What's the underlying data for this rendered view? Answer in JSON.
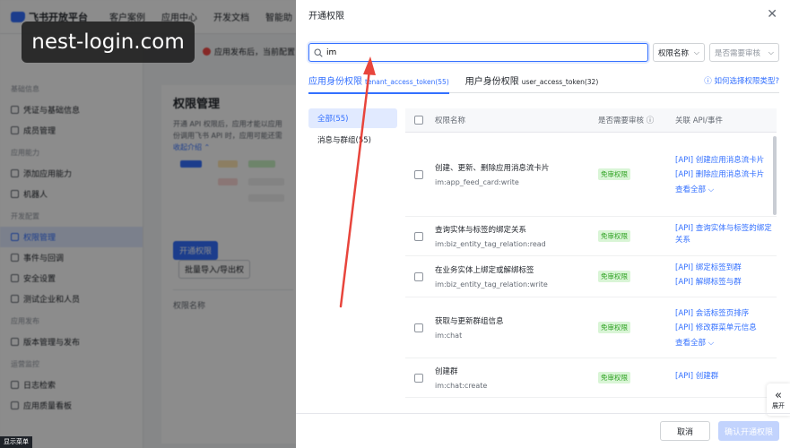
{
  "background": {
    "logo": "飞书开放平台",
    "topnav": [
      "客户案例",
      "应用中心",
      "开发文档",
      "智能助"
    ],
    "banner": "应用发布后，当前配置",
    "sidebar": {
      "sections": [
        {
          "title": "基础信息",
          "items": [
            "凭证与基础信息",
            "成员管理"
          ]
        },
        {
          "title": "应用能力",
          "items": [
            "添加应用能力",
            "机器人"
          ]
        },
        {
          "title": "开发配置",
          "items": [
            "权限管理",
            "事件与回调",
            "安全设置",
            "测试企业和人员"
          ]
        },
        {
          "title": "应用发布",
          "items": [
            "版本管理与发布"
          ]
        },
        {
          "title": "运营监控",
          "items": [
            "日志检索",
            "应用质量看板"
          ]
        }
      ],
      "active": "权限管理"
    },
    "content": {
      "title": "权限管理",
      "desc1": "开通 API 权限后，应用才能以应用",
      "desc2": "份调用飞书 API 时，应用可能还需",
      "collapse": "收起介绍",
      "btn_open": "开通权限",
      "btn_batch": "批量导入/导出权",
      "col_name": "权限名称"
    }
  },
  "watermark": "nest-login.com",
  "bottom_tag": "显示菜单",
  "drawer": {
    "title": "开通权限",
    "search": {
      "value": "im",
      "placeholder": "搜索"
    },
    "filter1": "权限名称",
    "filter2_placeholder": "是否需要审核",
    "tabs": [
      {
        "label": "应用身份权限",
        "sub": "tenant_access_token(55)"
      },
      {
        "label": "用户身份权限",
        "sub": "user_access_token(32)"
      }
    ],
    "help": "如何选择权限类型?",
    "left_nav": [
      "全部(55)",
      "消息与群组(55)"
    ],
    "columns": {
      "name": "权限名称",
      "review": "是否需要审核",
      "api": "关联 API/事件"
    },
    "rows": [
      {
        "name": "创建、更新、删除应用消息流卡片",
        "code": "im:app_feed_card:write",
        "badge": "免审权限",
        "apis": [
          "[API] 创建应用消息流卡片",
          "[API] 删除应用消息流卡片"
        ],
        "more": "查看全部"
      },
      {
        "name": "查询实体与标签的绑定关系",
        "code": "im:biz_entity_tag_relation:read",
        "badge": "免审权限",
        "apis": [
          "[API] 查询实体与标签的绑定关系"
        ],
        "more": ""
      },
      {
        "name": "在业务实体上绑定或解绑标签",
        "code": "im:biz_entity_tag_relation:write",
        "badge": "免审权限",
        "apis": [
          "[API] 绑定标签到群",
          "[API] 解绑标签与群"
        ],
        "more": ""
      },
      {
        "name": "获取与更新群组信息",
        "code": "im:chat",
        "badge": "免审权限",
        "apis": [
          "[API] 会话标签页排序",
          "[API] 修改群菜单元信息"
        ],
        "more": "查看全部"
      },
      {
        "name": "创建群",
        "code": "im:chat:create",
        "badge": "免审权限",
        "apis": [
          "[API] 创建群"
        ],
        "more": ""
      }
    ],
    "expand": "展开",
    "cancel": "取消",
    "confirm": "确认开通权限"
  },
  "colors": {
    "accent": "#3370ff",
    "badge_bg": "#d9f5d6",
    "badge_fg": "#2ea121",
    "arrow": "#e8453c"
  }
}
